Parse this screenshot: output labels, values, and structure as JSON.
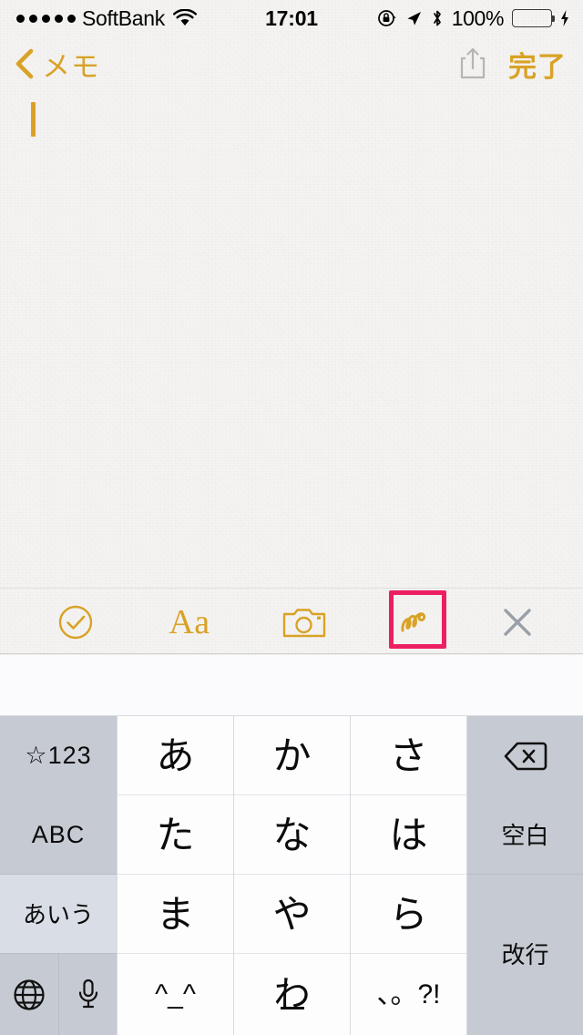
{
  "status_bar": {
    "signal_dots": 5,
    "carrier": "SoftBank",
    "wifi_icon": "wifi-icon",
    "time": "17:01",
    "rotation_lock_icon": "rotation-lock-icon",
    "location_icon": "location-arrow-icon",
    "bluetooth_icon": "bluetooth-icon",
    "battery_percent": "100%",
    "battery_color": "#4cd964",
    "charging_icon": "lightning-bolt-icon"
  },
  "nav_bar": {
    "back_icon": "chevron-left-icon",
    "back_label": "メモ",
    "share_icon": "share-icon",
    "done_label": "完了",
    "accent_color": "#d9a227",
    "share_color": "#b8b8b8"
  },
  "note": {
    "content": "",
    "caret_color": "#d9a227",
    "paper_color": "#f5f4f2"
  },
  "toolbar": {
    "accent_color": "#d9a227",
    "highlight_color": "#ec1f62",
    "items": [
      {
        "name": "checklist-button",
        "icon": "check-circle-icon",
        "label": "",
        "color": "#d9a227",
        "selected": false
      },
      {
        "name": "text-format-button",
        "icon": "text-format-icon",
        "label": "Aa",
        "color": "#d9a227",
        "selected": false
      },
      {
        "name": "camera-button",
        "icon": "camera-icon",
        "label": "",
        "color": "#d9a227",
        "selected": false
      },
      {
        "name": "sketch-button",
        "icon": "squiggle-sketch-icon",
        "label": "",
        "color": "#d9a227",
        "selected": true
      },
      {
        "name": "close-keyboard-button",
        "icon": "close-x-icon",
        "label": "",
        "color": "#9aa0a8",
        "selected": false
      }
    ]
  },
  "suggestion_bar": {
    "suggestions": []
  },
  "keyboard": {
    "layout": "japanese-kana-10key",
    "background_color": "#c6cad2",
    "key_color": "#fdfdfd",
    "function_key_color": "#c6cad2",
    "active_key_color": "#d9dee6",
    "rows": [
      {
        "keys": [
          {
            "name": "key-symbols-123",
            "label": "☆123",
            "type": "function"
          },
          {
            "name": "key-a-row",
            "label": "あ",
            "type": "kana"
          },
          {
            "name": "key-ka-row",
            "label": "か",
            "type": "kana"
          },
          {
            "name": "key-sa-row",
            "label": "さ",
            "type": "kana"
          },
          {
            "name": "key-delete",
            "label": "",
            "icon": "delete-backspace-icon",
            "type": "function"
          }
        ]
      },
      {
        "keys": [
          {
            "name": "key-abc",
            "label": "ABC",
            "type": "function"
          },
          {
            "name": "key-ta-row",
            "label": "た",
            "type": "kana"
          },
          {
            "name": "key-na-row",
            "label": "な",
            "type": "kana"
          },
          {
            "name": "key-ha-row",
            "label": "は",
            "type": "kana"
          },
          {
            "name": "key-space",
            "label": "空白",
            "type": "function"
          }
        ]
      },
      {
        "keys": [
          {
            "name": "key-kana-aiu",
            "label": "あいう",
            "type": "function",
            "active": true
          },
          {
            "name": "key-ma-row",
            "label": "ま",
            "type": "kana"
          },
          {
            "name": "key-ya-row",
            "label": "や",
            "type": "kana"
          },
          {
            "name": "key-ra-row",
            "label": "ら",
            "type": "kana"
          },
          {
            "name": "key-return",
            "label": "改行",
            "type": "function",
            "tall": true
          }
        ]
      },
      {
        "keys": [
          {
            "name": "key-globe",
            "label": "",
            "icon": "globe-icon",
            "type": "function"
          },
          {
            "name": "key-dictation",
            "label": "",
            "icon": "microphone-icon",
            "type": "function"
          },
          {
            "name": "key-emoticon",
            "label": "^_^",
            "type": "kana"
          },
          {
            "name": "key-wa-row",
            "label": "わ",
            "type": "kana",
            "underline": true
          },
          {
            "name": "key-punctuation",
            "label": "、。?!",
            "type": "kana"
          }
        ]
      }
    ]
  }
}
